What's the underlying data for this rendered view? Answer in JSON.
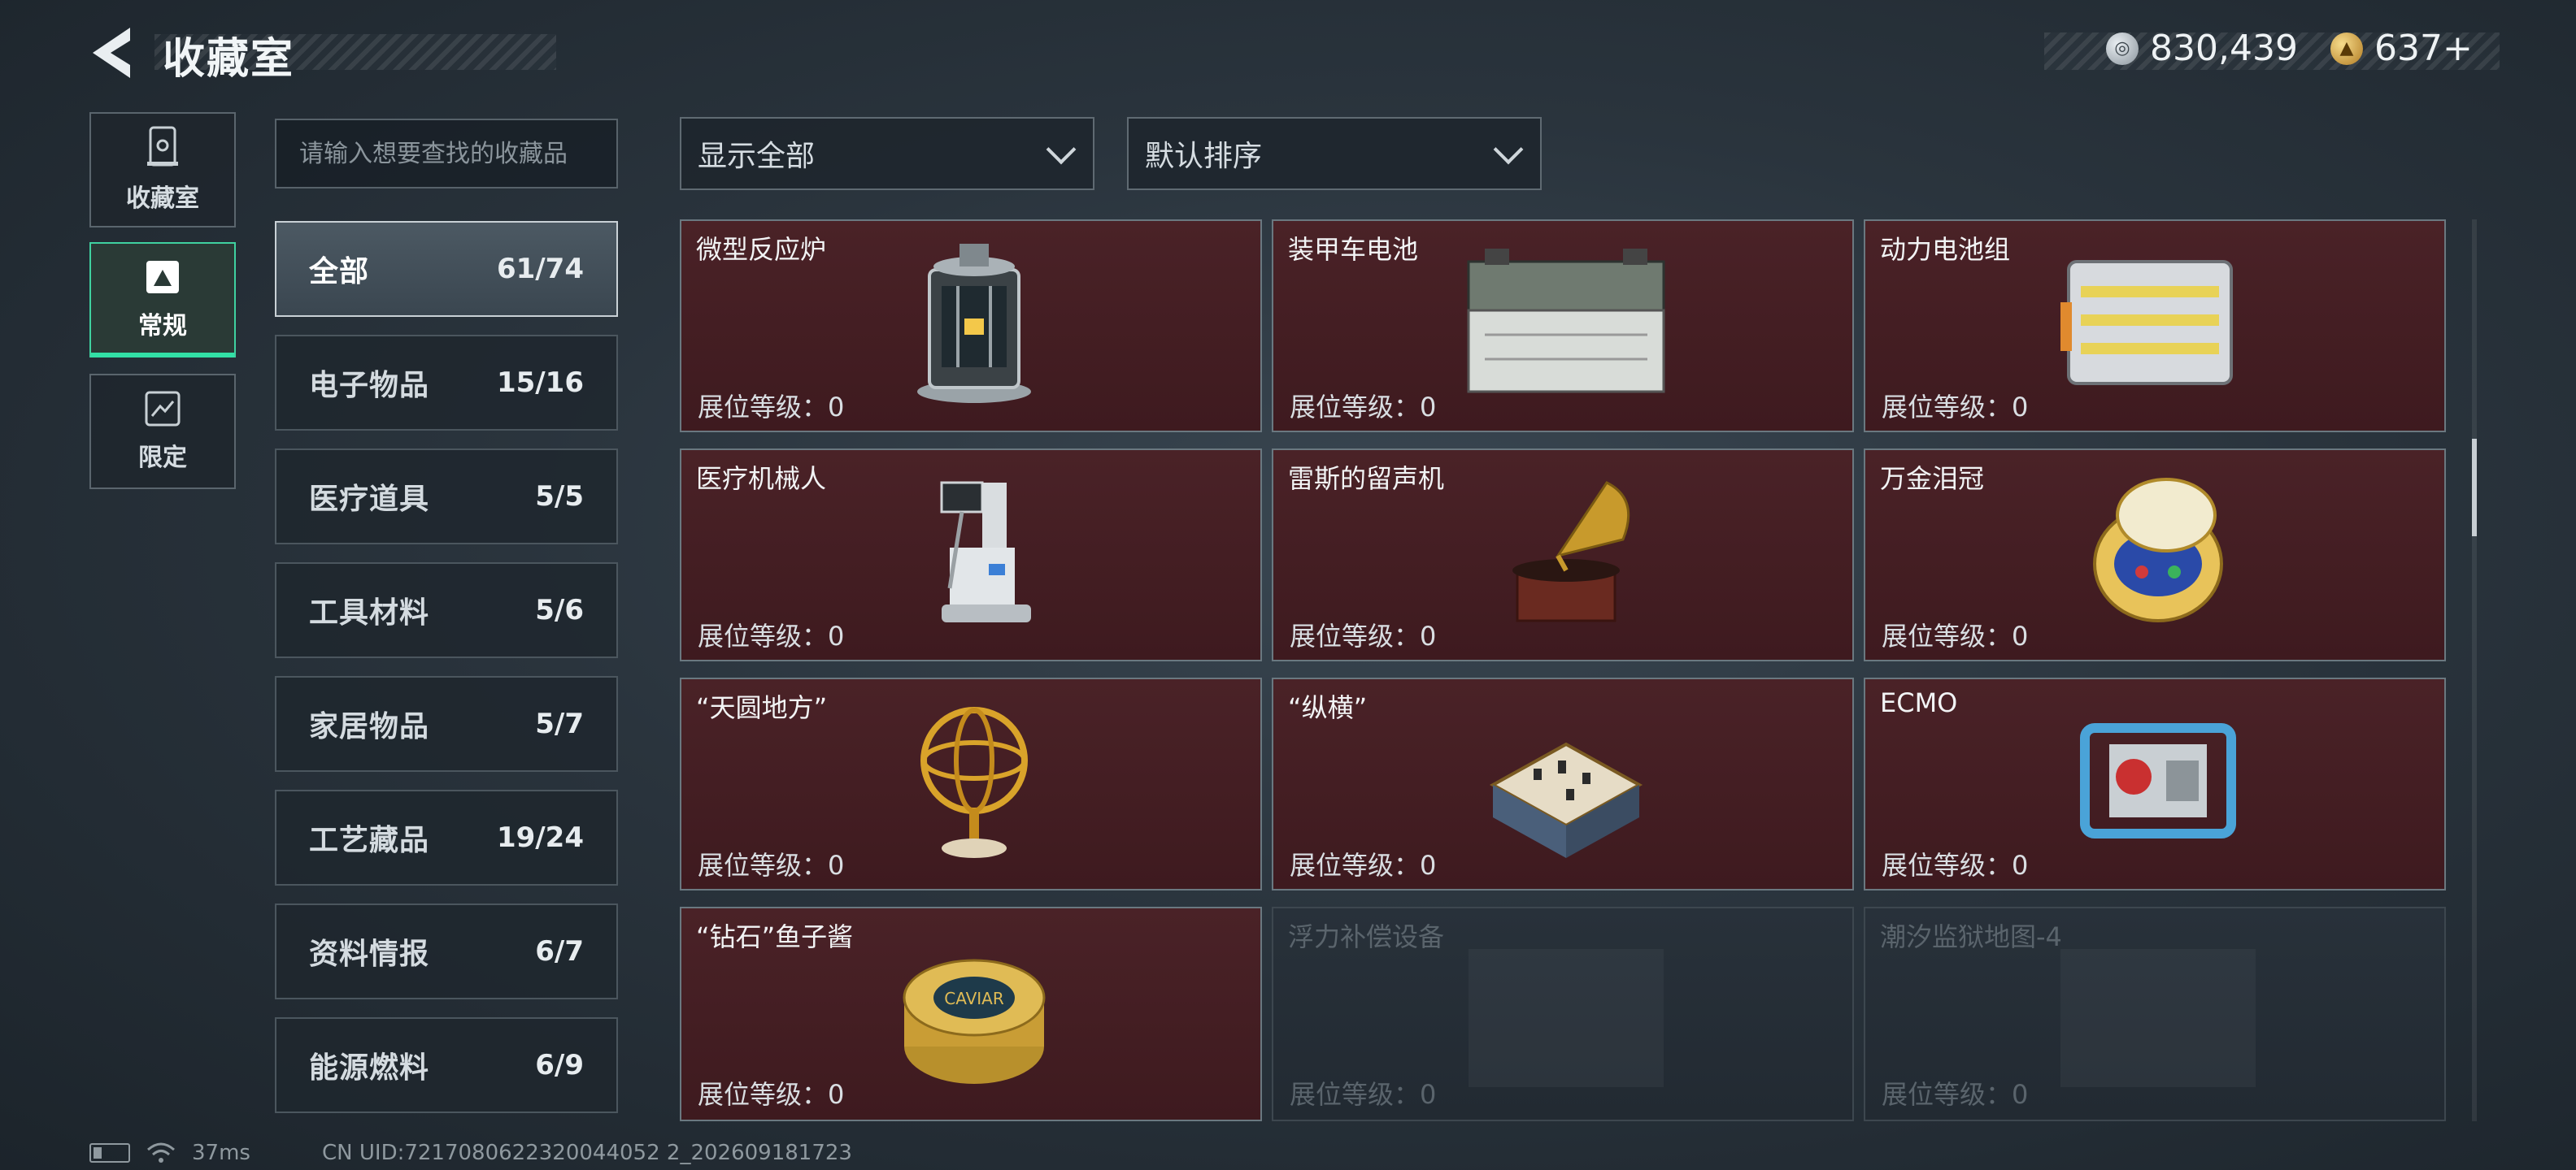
{
  "header": {
    "title": "收藏室",
    "back_icon": "back-arrow-icon",
    "currency": [
      {
        "icon": "silver-coin-icon",
        "value": "830,439"
      },
      {
        "icon": "gold-coin-icon",
        "value": "637+"
      }
    ]
  },
  "mode_tabs": [
    {
      "label": "收藏室",
      "icon": "collection-room-icon",
      "active": false
    },
    {
      "label": "常规",
      "icon": "regular-icon",
      "active": true
    },
    {
      "label": "限定",
      "icon": "limited-icon",
      "active": false
    }
  ],
  "search": {
    "placeholder": "请输入想要查找的收藏品"
  },
  "categories": [
    {
      "name": "全部",
      "count": "61/74",
      "active": true
    },
    {
      "name": "电子物品",
      "count": "15/16"
    },
    {
      "name": "医疗道具",
      "count": "5/5"
    },
    {
      "name": "工具材料",
      "count": "5/6"
    },
    {
      "name": "家居物品",
      "count": "5/7"
    },
    {
      "name": "工艺藏品",
      "count": "19/24"
    },
    {
      "name": "资料情报",
      "count": "6/7"
    },
    {
      "name": "能源燃料",
      "count": "6/9"
    }
  ],
  "filters": {
    "display": "显示全部",
    "sort": "默认排序"
  },
  "items": [
    {
      "name": "微型反应炉",
      "level": "展位等级：0",
      "icon": "micro-reactor-icon",
      "locked": false
    },
    {
      "name": "装甲车电池",
      "level": "展位等级：0",
      "icon": "armored-battery-icon",
      "locked": false
    },
    {
      "name": "动力电池组",
      "level": "展位等级：0",
      "icon": "power-battery-pack-icon",
      "locked": false
    },
    {
      "name": "医疗机械人",
      "level": "展位等级：0",
      "icon": "medical-robot-icon",
      "locked": false
    },
    {
      "name": "雷斯的留声机",
      "level": "展位等级：0",
      "icon": "gramophone-icon",
      "locked": false
    },
    {
      "name": "万金泪冠",
      "level": "展位等级：0",
      "icon": "jeweled-egg-icon",
      "locked": false
    },
    {
      "name": "“天圆地方”",
      "level": "展位等级：0",
      "icon": "armillary-sphere-icon",
      "locked": false
    },
    {
      "name": "“纵横”",
      "level": "展位等级：0",
      "icon": "chess-box-icon",
      "locked": false
    },
    {
      "name": "ECMO",
      "level": "展位等级：0",
      "icon": "ecmo-machine-icon",
      "locked": false
    },
    {
      "name": "“钻石”鱼子酱",
      "level": "展位等级：0",
      "icon": "caviar-tin-icon",
      "locked": false
    },
    {
      "name": "浮力补偿设备",
      "level": "展位等级：0",
      "icon": "buoyancy-device-icon",
      "locked": true
    },
    {
      "name": "潮汐监狱地图-4",
      "level": "展位等级：0",
      "icon": "prison-map-icon",
      "locked": true
    }
  ],
  "footer": {
    "ping": "37ms",
    "uid": "CN UID:7217080622320044052 2_202609181723"
  }
}
